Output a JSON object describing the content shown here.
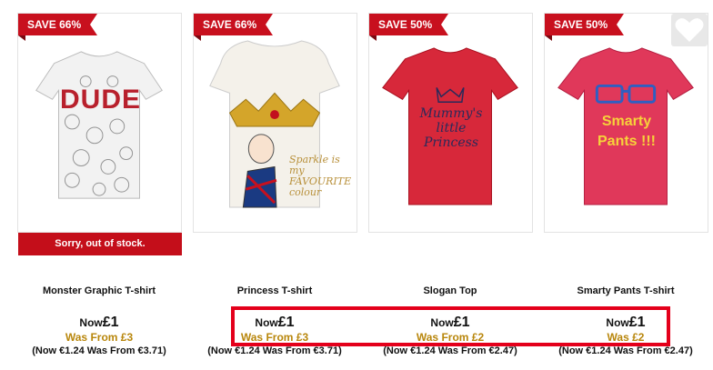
{
  "products": [
    {
      "badge": "SAVE 66%",
      "name": "Monster Graphic T-shirt",
      "now_label": "Now",
      "now_price": "£1",
      "was": "Was From £3",
      "eur": "(Now €1.24 Was From €3.71)",
      "out_of_stock": "Sorry, out of stock.",
      "shirt_color": "#f2f2f2",
      "print_text": "DUDE"
    },
    {
      "badge": "SAVE 66%",
      "name": "Princess T-shirt",
      "now_label": "Now",
      "now_price": "£1",
      "was": "Was From £3",
      "eur": "(Now €1.24 Was From €3.71)",
      "shirt_color": "#f4f1ea",
      "print_text": "Sparkle is my FAVOURITE colour"
    },
    {
      "badge": "SAVE 50%",
      "name": "Slogan Top",
      "now_label": "Now",
      "now_price": "£1",
      "was": "Was From £2",
      "eur": "(Now €1.24 Was From €2.47)",
      "shirt_color": "#d7283a",
      "print_text": "Mummy's little Princess"
    },
    {
      "badge": "SAVE 50%",
      "name": "Smarty Pants T-shirt",
      "now_label": "Now",
      "now_price": "£1",
      "was": "Was £2",
      "eur": "(Now €1.24 Was From €2.47)",
      "shirt_color": "#e0385a",
      "print_text": "Smarty Pants !!!"
    }
  ],
  "colors": {
    "sale_red": "#c8101e",
    "was_gold": "#b8860b",
    "highlight": "#e4001b"
  },
  "icons": {
    "wishlist": "heart-icon"
  }
}
